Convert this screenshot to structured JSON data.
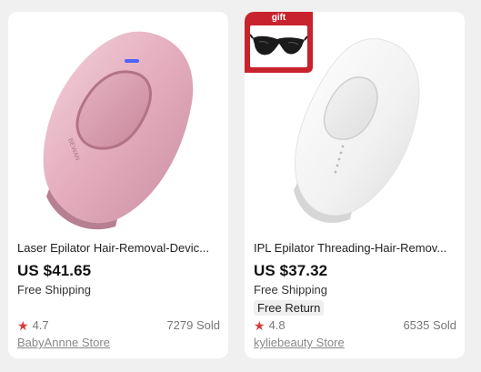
{
  "products": [
    {
      "title": "Laser Epilator Hair-Removal-Devic...",
      "price": "US $41.65",
      "shipping": "Free Shipping",
      "rating": "4.7",
      "sold": "7279 Sold",
      "store": "BabyAnnne Store",
      "device_color": "#e8b8c6"
    },
    {
      "title": "IPL Epilator Threading-Hair-Remov...",
      "price": "US $37.32",
      "shipping": "Free Shipping",
      "badge": "Free Return",
      "gift_label": "gift",
      "rating": "4.8",
      "sold": "6535 Sold",
      "store": "kyliebeauty Store",
      "device_color": "#fafafa"
    }
  ],
  "icons": {
    "rating": "star-icon",
    "gift_item": "sunglasses-icon"
  },
  "colors": {
    "star": "#d93a3a",
    "gift_badge": "#c8232c"
  }
}
